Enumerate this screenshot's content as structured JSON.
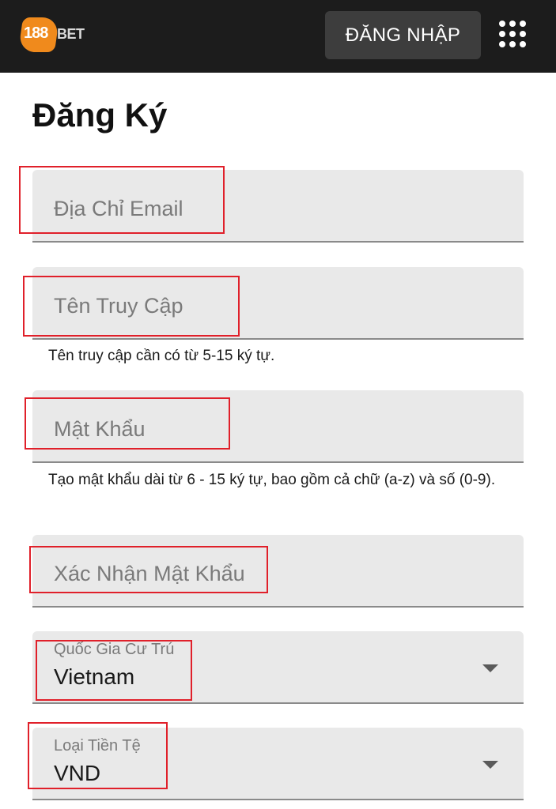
{
  "header": {
    "logo_number": "188",
    "logo_word": "BET",
    "login_label": "ĐĂNG NHẬP",
    "menu_icon": "grid-menu-icon",
    "background_color": "#1c1c1c"
  },
  "page": {
    "title": "Đăng Ký"
  },
  "form": {
    "email": {
      "placeholder": "Địa Chỉ Email"
    },
    "username": {
      "placeholder": "Tên Truy Cập",
      "helper": "Tên truy cập cần có từ 5-15 ký tự."
    },
    "password": {
      "placeholder": "Mật Khẩu",
      "helper": "Tạo mật khẩu dài từ 6 - 15 ký tự, bao gồm cả chữ (a-z) và số (0-9)."
    },
    "confirm_password": {
      "placeholder": "Xác Nhận Mật Khẩu"
    },
    "country": {
      "label": "Quốc Gia Cư Trú",
      "value": "Vietnam"
    },
    "currency": {
      "label": "Loại Tiền Tệ",
      "value": "VND"
    }
  },
  "annotation_color": "#e0202a"
}
